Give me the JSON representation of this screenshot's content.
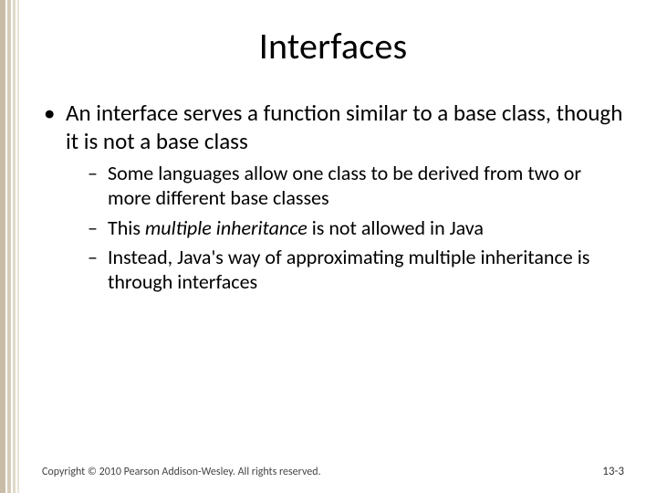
{
  "title": "Interfaces",
  "bullets": {
    "main": "An interface serves a function similar to a base class, though it is not a base class",
    "sub": [
      {
        "text": "Some languages allow one class to be derived from two or more different base classes"
      },
      {
        "before": "This ",
        "em": "multiple inheritance",
        "after": " is not allowed in Java"
      },
      {
        "text": "Instead, Java's way of approximating multiple inheritance is through interfaces"
      }
    ]
  },
  "footer": {
    "copyright": "Copyright © 2010 Pearson Addison-Wesley. All rights reserved.",
    "page": "13-3"
  }
}
